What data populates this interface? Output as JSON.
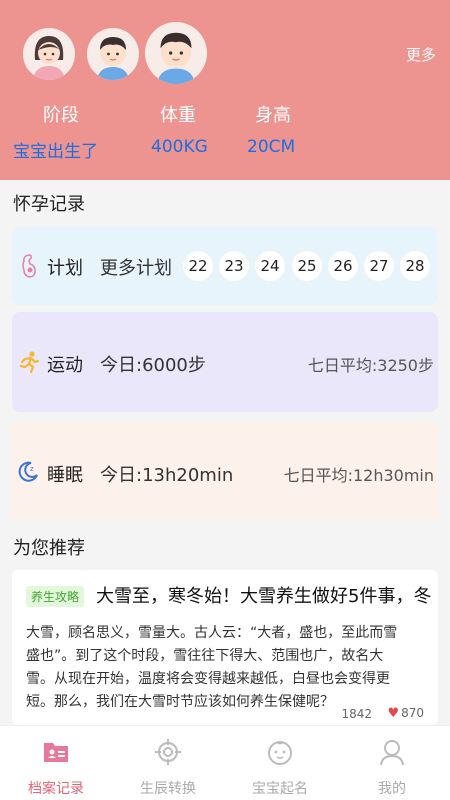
{
  "header": {
    "more_label": "更多",
    "stats": [
      {
        "label": "阶段",
        "value": "宝宝出生了"
      },
      {
        "label": "体重",
        "value": "400KG"
      },
      {
        "label": "身高",
        "value": "20CM"
      }
    ],
    "avatars": [
      "mother-avatar",
      "baby-boy-avatar",
      "baby-boy-avatar-selected"
    ]
  },
  "pregnancy": {
    "title": "怀孕记录",
    "plan": {
      "icon": "pregnancy-icon",
      "label": "计划",
      "more": "更多计划",
      "days": [
        "22",
        "23",
        "24",
        "25",
        "26",
        "27",
        "28"
      ]
    },
    "sport": {
      "icon": "running-icon",
      "label": "运动",
      "today": "今日:6000步",
      "avg": "七日平均:3250步"
    },
    "sleep": {
      "icon": "moon-icon",
      "label": "睡眠",
      "today": "今日:13h20min",
      "avg": "七日平均:12h30min"
    }
  },
  "recommend": {
    "title": "为您推荐",
    "article": {
      "tag": "养生攻略",
      "title": "大雪至，寒冬始！大雪养生做好5件事，冬",
      "lines": [
        "大雪，顾名思义，雪量大。古人云：“大者，盛也，至此而雪",
        "盛也”。到了这个时段，雪往往下得大、范围也广，故名大",
        "雪。从现在开始，温度将会变得越来越低，白昼也会变得更",
        "短。那么，我们在大雪时节应该如何养生保健呢？"
      ],
      "views": "1842",
      "likes": "870"
    }
  },
  "tabbar": {
    "tabs": [
      {
        "label": "档案记录",
        "icon": "archive-icon",
        "active": true
      },
      {
        "label": "生辰转换",
        "icon": "target-icon",
        "active": false
      },
      {
        "label": "宝宝起名",
        "icon": "baby-face-icon",
        "active": false
      },
      {
        "label": "我的",
        "icon": "user-icon",
        "active": false
      }
    ]
  },
  "colors": {
    "header_bg": "#ed9390",
    "value_blue": "#1b6fe0",
    "tab_active": "#e3647a",
    "tag_green": "#44a532"
  }
}
